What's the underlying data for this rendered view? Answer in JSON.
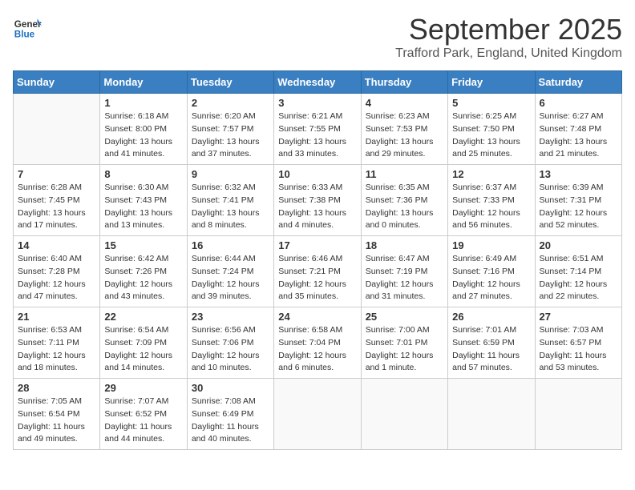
{
  "header": {
    "logo_line1": "General",
    "logo_line2": "Blue",
    "month_title": "September 2025",
    "location": "Trafford Park, England, United Kingdom"
  },
  "weekdays": [
    "Sunday",
    "Monday",
    "Tuesday",
    "Wednesday",
    "Thursday",
    "Friday",
    "Saturday"
  ],
  "weeks": [
    [
      {
        "day": "",
        "sunrise": "",
        "sunset": "",
        "daylight": ""
      },
      {
        "day": "1",
        "sunrise": "Sunrise: 6:18 AM",
        "sunset": "Sunset: 8:00 PM",
        "daylight": "Daylight: 13 hours and 41 minutes."
      },
      {
        "day": "2",
        "sunrise": "Sunrise: 6:20 AM",
        "sunset": "Sunset: 7:57 PM",
        "daylight": "Daylight: 13 hours and 37 minutes."
      },
      {
        "day": "3",
        "sunrise": "Sunrise: 6:21 AM",
        "sunset": "Sunset: 7:55 PM",
        "daylight": "Daylight: 13 hours and 33 minutes."
      },
      {
        "day": "4",
        "sunrise": "Sunrise: 6:23 AM",
        "sunset": "Sunset: 7:53 PM",
        "daylight": "Daylight: 13 hours and 29 minutes."
      },
      {
        "day": "5",
        "sunrise": "Sunrise: 6:25 AM",
        "sunset": "Sunset: 7:50 PM",
        "daylight": "Daylight: 13 hours and 25 minutes."
      },
      {
        "day": "6",
        "sunrise": "Sunrise: 6:27 AM",
        "sunset": "Sunset: 7:48 PM",
        "daylight": "Daylight: 13 hours and 21 minutes."
      }
    ],
    [
      {
        "day": "7",
        "sunrise": "Sunrise: 6:28 AM",
        "sunset": "Sunset: 7:45 PM",
        "daylight": "Daylight: 13 hours and 17 minutes."
      },
      {
        "day": "8",
        "sunrise": "Sunrise: 6:30 AM",
        "sunset": "Sunset: 7:43 PM",
        "daylight": "Daylight: 13 hours and 13 minutes."
      },
      {
        "day": "9",
        "sunrise": "Sunrise: 6:32 AM",
        "sunset": "Sunset: 7:41 PM",
        "daylight": "Daylight: 13 hours and 8 minutes."
      },
      {
        "day": "10",
        "sunrise": "Sunrise: 6:33 AM",
        "sunset": "Sunset: 7:38 PM",
        "daylight": "Daylight: 13 hours and 4 minutes."
      },
      {
        "day": "11",
        "sunrise": "Sunrise: 6:35 AM",
        "sunset": "Sunset: 7:36 PM",
        "daylight": "Daylight: 13 hours and 0 minutes."
      },
      {
        "day": "12",
        "sunrise": "Sunrise: 6:37 AM",
        "sunset": "Sunset: 7:33 PM",
        "daylight": "Daylight: 12 hours and 56 minutes."
      },
      {
        "day": "13",
        "sunrise": "Sunrise: 6:39 AM",
        "sunset": "Sunset: 7:31 PM",
        "daylight": "Daylight: 12 hours and 52 minutes."
      }
    ],
    [
      {
        "day": "14",
        "sunrise": "Sunrise: 6:40 AM",
        "sunset": "Sunset: 7:28 PM",
        "daylight": "Daylight: 12 hours and 47 minutes."
      },
      {
        "day": "15",
        "sunrise": "Sunrise: 6:42 AM",
        "sunset": "Sunset: 7:26 PM",
        "daylight": "Daylight: 12 hours and 43 minutes."
      },
      {
        "day": "16",
        "sunrise": "Sunrise: 6:44 AM",
        "sunset": "Sunset: 7:24 PM",
        "daylight": "Daylight: 12 hours and 39 minutes."
      },
      {
        "day": "17",
        "sunrise": "Sunrise: 6:46 AM",
        "sunset": "Sunset: 7:21 PM",
        "daylight": "Daylight: 12 hours and 35 minutes."
      },
      {
        "day": "18",
        "sunrise": "Sunrise: 6:47 AM",
        "sunset": "Sunset: 7:19 PM",
        "daylight": "Daylight: 12 hours and 31 minutes."
      },
      {
        "day": "19",
        "sunrise": "Sunrise: 6:49 AM",
        "sunset": "Sunset: 7:16 PM",
        "daylight": "Daylight: 12 hours and 27 minutes."
      },
      {
        "day": "20",
        "sunrise": "Sunrise: 6:51 AM",
        "sunset": "Sunset: 7:14 PM",
        "daylight": "Daylight: 12 hours and 22 minutes."
      }
    ],
    [
      {
        "day": "21",
        "sunrise": "Sunrise: 6:53 AM",
        "sunset": "Sunset: 7:11 PM",
        "daylight": "Daylight: 12 hours and 18 minutes."
      },
      {
        "day": "22",
        "sunrise": "Sunrise: 6:54 AM",
        "sunset": "Sunset: 7:09 PM",
        "daylight": "Daylight: 12 hours and 14 minutes."
      },
      {
        "day": "23",
        "sunrise": "Sunrise: 6:56 AM",
        "sunset": "Sunset: 7:06 PM",
        "daylight": "Daylight: 12 hours and 10 minutes."
      },
      {
        "day": "24",
        "sunrise": "Sunrise: 6:58 AM",
        "sunset": "Sunset: 7:04 PM",
        "daylight": "Daylight: 12 hours and 6 minutes."
      },
      {
        "day": "25",
        "sunrise": "Sunrise: 7:00 AM",
        "sunset": "Sunset: 7:01 PM",
        "daylight": "Daylight: 12 hours and 1 minute."
      },
      {
        "day": "26",
        "sunrise": "Sunrise: 7:01 AM",
        "sunset": "Sunset: 6:59 PM",
        "daylight": "Daylight: 11 hours and 57 minutes."
      },
      {
        "day": "27",
        "sunrise": "Sunrise: 7:03 AM",
        "sunset": "Sunset: 6:57 PM",
        "daylight": "Daylight: 11 hours and 53 minutes."
      }
    ],
    [
      {
        "day": "28",
        "sunrise": "Sunrise: 7:05 AM",
        "sunset": "Sunset: 6:54 PM",
        "daylight": "Daylight: 11 hours and 49 minutes."
      },
      {
        "day": "29",
        "sunrise": "Sunrise: 7:07 AM",
        "sunset": "Sunset: 6:52 PM",
        "daylight": "Daylight: 11 hours and 44 minutes."
      },
      {
        "day": "30",
        "sunrise": "Sunrise: 7:08 AM",
        "sunset": "Sunset: 6:49 PM",
        "daylight": "Daylight: 11 hours and 40 minutes."
      },
      {
        "day": "",
        "sunrise": "",
        "sunset": "",
        "daylight": ""
      },
      {
        "day": "",
        "sunrise": "",
        "sunset": "",
        "daylight": ""
      },
      {
        "day": "",
        "sunrise": "",
        "sunset": "",
        "daylight": ""
      },
      {
        "day": "",
        "sunrise": "",
        "sunset": "",
        "daylight": ""
      }
    ]
  ]
}
